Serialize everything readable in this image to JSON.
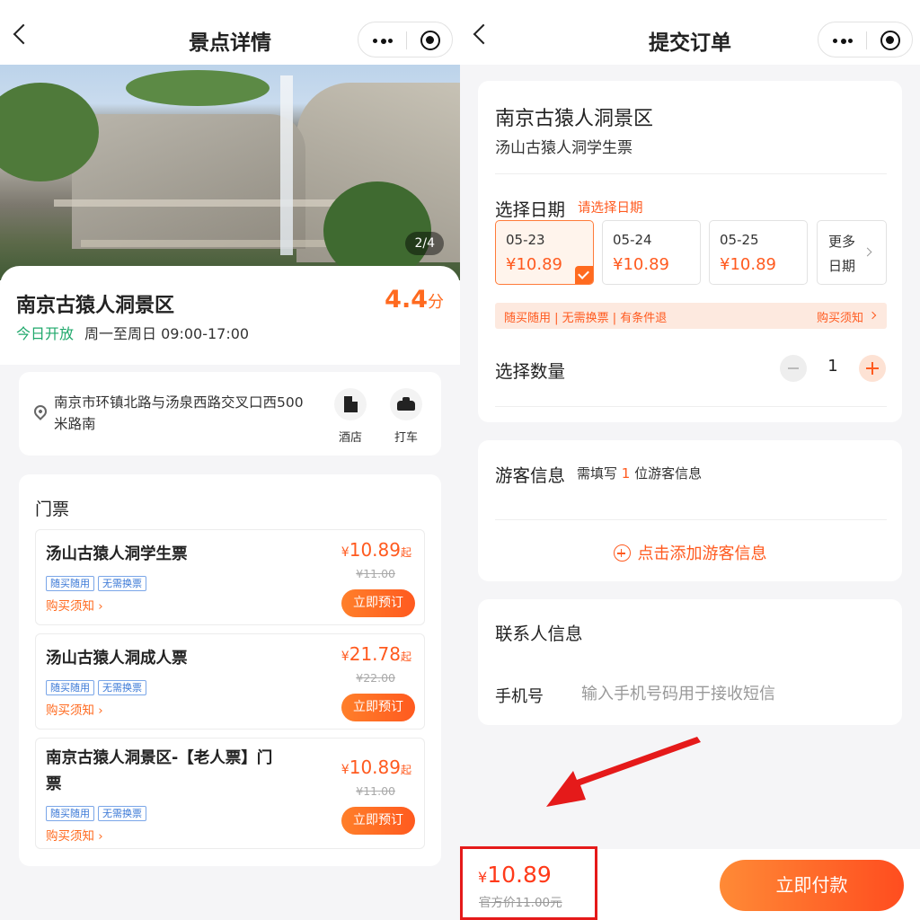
{
  "left": {
    "nav_title": "景点详情",
    "pager": "2/4",
    "spot": {
      "name": "南京古猿人洞景区",
      "score": "4.4",
      "score_unit": "分",
      "open_tag": "今日开放",
      "hours": "周一至周日 09:00-17:00"
    },
    "address": {
      "text": "南京市环镇北路与汤泉西路交叉口西500米路南",
      "hotel_label": "酒店",
      "taxi_label": "打车"
    },
    "tickets": {
      "heading": "门票",
      "currency": "¥",
      "from": "起",
      "tag1": "随买随用",
      "tag2": "无需换票",
      "notice": "购买须知",
      "book": "立即预订",
      "items": [
        {
          "name": "汤山古猿人洞学生票",
          "price": "10.89",
          "old": "¥11.00"
        },
        {
          "name": "汤山古猿人洞成人票",
          "price": "21.78",
          "old": "¥22.00"
        },
        {
          "name": "南京古猿人洞景区-【老人票】门票",
          "price": "10.89",
          "old": "¥11.00"
        }
      ]
    }
  },
  "right": {
    "nav_title": "提交订单",
    "order": {
      "title": "南京古猿人洞景区",
      "ticket": "汤山古猿人洞学生票",
      "date_label": "选择日期",
      "date_hint": "请选择日期",
      "dates": [
        {
          "date": "05-23",
          "price": "¥10.89"
        },
        {
          "date": "05-24",
          "price": "¥10.89"
        },
        {
          "date": "05-25",
          "price": "¥10.89"
        }
      ],
      "more1": "更多",
      "more2": "日期",
      "policy": "随买随用 | 无需换票 | 有条件退",
      "policy_link": "购买须知",
      "qty_label": "选择数量",
      "qty": "1"
    },
    "guest": {
      "title": "游客信息",
      "hint_pre": "需填写",
      "hint_num": "1",
      "hint_post": "位游客信息",
      "add": "点击添加游客信息"
    },
    "contact": {
      "title": "联系人信息",
      "phone_label": "手机号",
      "phone_placeholder": "输入手机号码用于接收短信"
    },
    "pay": {
      "currency": "¥",
      "price": "10.89",
      "old": "官方价11.00元",
      "button": "立即付款"
    }
  },
  "colors": {
    "accent": "#ff5a1f",
    "open": "#1fa86b",
    "highlight": "#e51a1a"
  }
}
